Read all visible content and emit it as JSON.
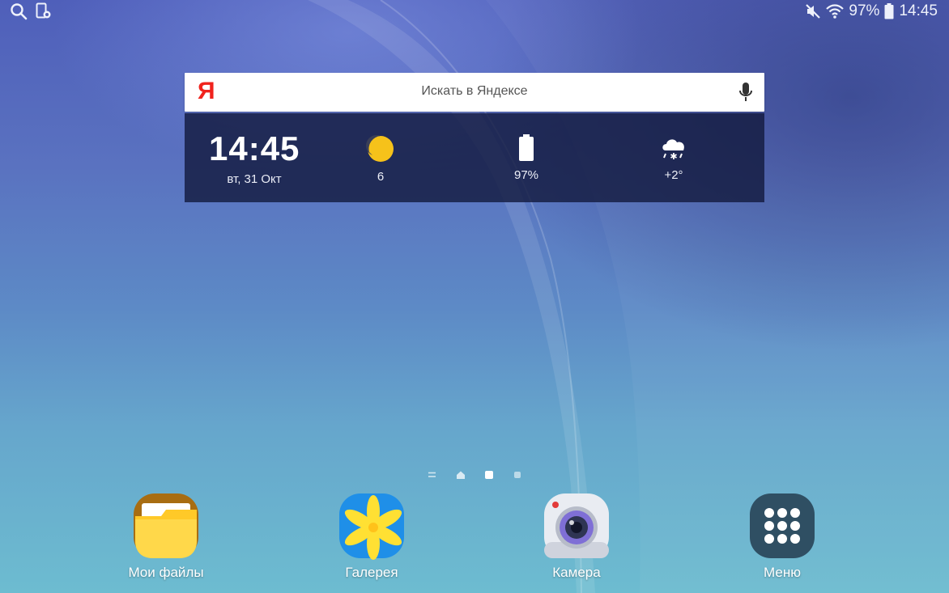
{
  "status_bar": {
    "battery_percent": "97%",
    "time": "14:45",
    "left_icons": [
      "search-icon",
      "screen-record-icon"
    ],
    "right_icons": [
      "mute-icon",
      "wifi-icon",
      "battery-icon"
    ]
  },
  "search": {
    "logo_letter": "Я",
    "placeholder": "Искать в Яндексе",
    "icon": "mic-icon"
  },
  "widget": {
    "time": "14:45",
    "date": "вт, 31 Окт",
    "traffic_value": "6",
    "battery_value": "97%",
    "weather_value": "+2°",
    "icons": [
      "traffic-icon",
      "battery-icon",
      "snow-cloud-icon"
    ]
  },
  "page_indicator": {
    "pages": 4,
    "active_index": 2
  },
  "dock": [
    {
      "label": "Мои файлы",
      "icon": "folder-icon"
    },
    {
      "label": "Галерея",
      "icon": "gallery-flower-icon"
    },
    {
      "label": "Камера",
      "icon": "camera-icon"
    },
    {
      "label": "Меню",
      "icon": "apps-grid-icon"
    }
  ],
  "colors": {
    "yandex_red": "#f0231d",
    "traffic_yellow": "#f6c21a",
    "widget_bg": "#141b40"
  }
}
